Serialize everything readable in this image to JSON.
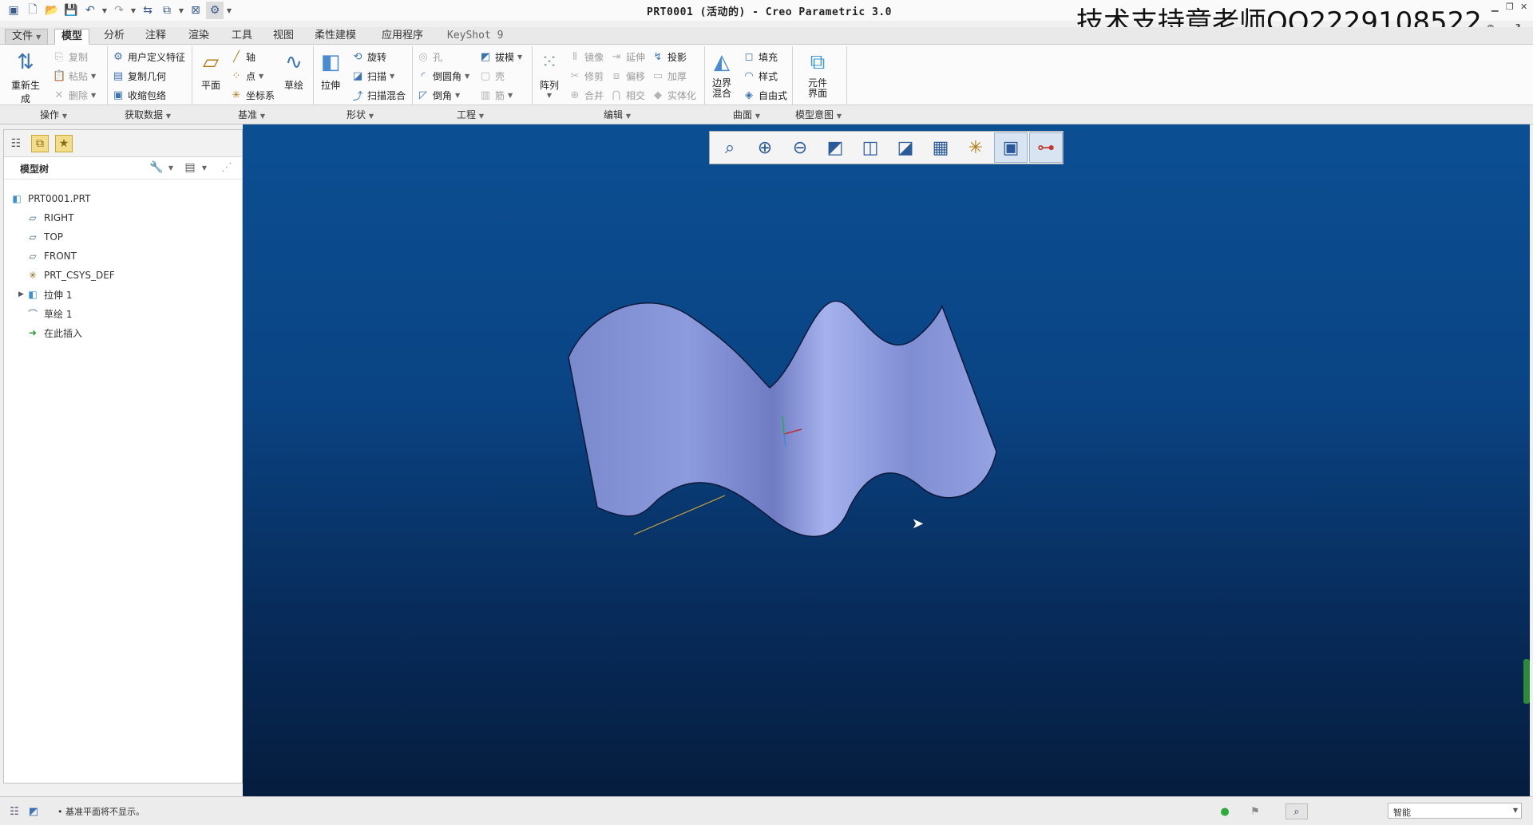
{
  "window": {
    "title": "PRT0001 (活动的) - Creo Parametric 3.0",
    "watermark": "技术支持章老师QQ2229108522"
  },
  "tabs": [
    {
      "label": "文件",
      "id": "file"
    },
    {
      "label": "模型",
      "id": "model"
    },
    {
      "label": "分析",
      "id": "analysis"
    },
    {
      "label": "注释",
      "id": "annotate"
    },
    {
      "label": "渲染",
      "id": "render"
    },
    {
      "label": "工具",
      "id": "tools"
    },
    {
      "label": "视图",
      "id": "view"
    },
    {
      "label": "柔性建模",
      "id": "flexible"
    },
    {
      "label": "应用程序",
      "id": "applications"
    },
    {
      "label": "KeyShot 9",
      "id": "keyshot"
    }
  ],
  "ribbon": {
    "operations": {
      "regenerate": "重新生成",
      "copy": "复制",
      "paste": "粘贴",
      "delete": "删除",
      "group": "操作"
    },
    "get_data": {
      "udf": "用户定义特征",
      "copy_geom": "复制几何",
      "shrinkwrap": "收缩包络",
      "group": "获取数据"
    },
    "datum": {
      "plane": "平面",
      "axis": "轴",
      "point": "点",
      "csys": "坐标系",
      "sketch": "草绘",
      "group": "基准"
    },
    "shapes": {
      "extrude": "拉伸",
      "revolve": "旋转",
      "sweep": "扫描",
      "swept_blend": "扫描混合",
      "group": "形状"
    },
    "engineering": {
      "hole": "孔",
      "round": "倒圆角",
      "chamfer": "倒角",
      "draft": "拔模",
      "shell": "壳",
      "rib": "筋",
      "group": "工程"
    },
    "editing": {
      "pattern": "阵列",
      "mirror": "镜像",
      "extend": "延伸",
      "project": "投影",
      "trim": "修剪",
      "offset": "偏移",
      "thicken": "加厚",
      "merge": "合并",
      "intersect": "相交",
      "solidify": "实体化",
      "group": "编辑"
    },
    "surfaces": {
      "boundary_blend": "边界混合",
      "fill": "填充",
      "style": "样式",
      "freestyle": "自由式",
      "group": "曲面"
    },
    "model_intent": {
      "component_interface": "元件界面",
      "group": "模型意图"
    }
  },
  "model_tree": {
    "title": "模型树",
    "items": [
      {
        "label": "PRT0001.PRT",
        "icon": "part-icon"
      },
      {
        "label": "RIGHT",
        "icon": "datum-plane-icon"
      },
      {
        "label": "TOP",
        "icon": "datum-plane-icon"
      },
      {
        "label": "FRONT",
        "icon": "datum-plane-icon"
      },
      {
        "label": "PRT_CSYS_DEF",
        "icon": "csys-icon"
      },
      {
        "label": "拉伸 1",
        "icon": "extrude-icon"
      },
      {
        "label": "草绘 1",
        "icon": "sketch-icon"
      },
      {
        "label": "在此插入",
        "icon": "insert-here-icon"
      }
    ]
  },
  "view_toolbar": [
    "refit-icon",
    "zoom-in-icon",
    "zoom-out-icon",
    "repaint-icon",
    "display-style-icon",
    "saved-orientations-icon",
    "view-manager-icon",
    "datum-display-icon",
    "annotation-display-icon",
    "spin-center-icon"
  ],
  "statusbar": {
    "message": "• 基准平面将不显示。",
    "filter": "智能"
  },
  "colors": {
    "viewport_top": "#0b4f93",
    "viewport_bottom": "#051d3e",
    "surface": "#8b99dc",
    "accent": "#3b74b5"
  }
}
